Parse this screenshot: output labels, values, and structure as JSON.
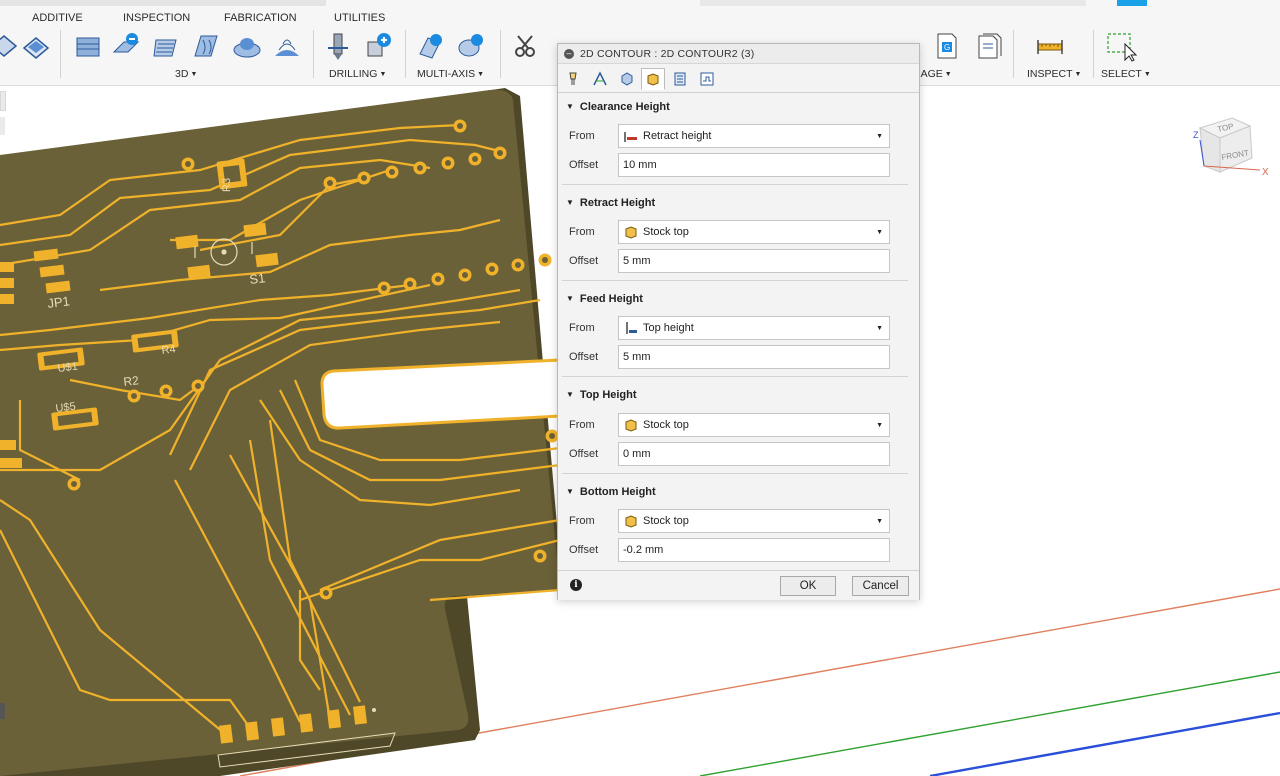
{
  "toolbar": {
    "tabs": [
      "ADDITIVE",
      "INSPECTION",
      "FABRICATION",
      "UTILITIES"
    ],
    "groups": {
      "g3d": "3D",
      "drilling": "DRILLING",
      "multiaxis": "MULTI-AXIS",
      "manage": "NAGE",
      "inspect": "INSPECT",
      "select": "SELECT"
    }
  },
  "dialog": {
    "title": "2D CONTOUR : 2D CONTOUR2 (3)",
    "sections": [
      {
        "title": "Clearance Height",
        "from_label": "From",
        "from_value": "Retract height",
        "offset_label": "Offset",
        "offset_value": "10 mm"
      },
      {
        "title": "Retract Height",
        "from_label": "From",
        "from_value": "Stock top",
        "offset_label": "Offset",
        "offset_value": "5 mm"
      },
      {
        "title": "Feed Height",
        "from_label": "From",
        "from_value": "Top height",
        "offset_label": "Offset",
        "offset_value": "5 mm"
      },
      {
        "title": "Top Height",
        "from_label": "From",
        "from_value": "Stock top",
        "offset_label": "Offset",
        "offset_value": "0 mm"
      },
      {
        "title": "Bottom Height",
        "from_label": "From",
        "from_value": "Stock top",
        "offset_label": "Offset",
        "offset_value": "-0.2 mm"
      }
    ],
    "ok_label": "OK",
    "cancel_label": "Cancel"
  },
  "pcb_labels": {
    "r3": "R3",
    "s1": "S1",
    "jp1": "JP1",
    "r4": "R4",
    "us1": "U$1",
    "r2": "R2",
    "us5": "U$5"
  },
  "viewcube": {
    "top": "TOP",
    "front": "FRONT",
    "x_axis": "X",
    "z_axis": "Z"
  },
  "colors": {
    "board": "#6b6138",
    "copper": "#f0b22a",
    "x_axis": "#e0805e",
    "y_axis": "#2fa12f",
    "z_axis": "#2a4fd8",
    "select_accent": "#1aa0e6"
  }
}
